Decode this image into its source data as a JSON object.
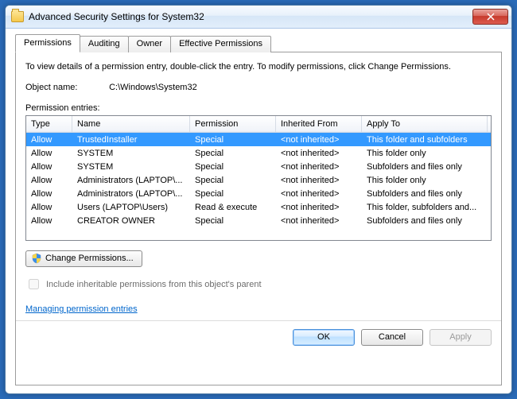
{
  "window": {
    "title": "Advanced Security Settings for System32"
  },
  "tabs": [
    {
      "label": "Permissions",
      "active": true
    },
    {
      "label": "Auditing",
      "active": false
    },
    {
      "label": "Owner",
      "active": false
    },
    {
      "label": "Effective Permissions",
      "active": false
    }
  ],
  "panel": {
    "intro": "To view details of a permission entry, double-click the entry. To modify permissions, click Change Permissions.",
    "object_label": "Object name:",
    "object_value": "C:\\Windows\\System32",
    "entries_label": "Permission entries:",
    "columns": {
      "type": "Type",
      "name": "Name",
      "permission": "Permission",
      "inherited": "Inherited From",
      "apply": "Apply To"
    },
    "rows": [
      {
        "type": "Allow",
        "name": "TrustedInstaller",
        "permission": "Special",
        "inherited": "<not inherited>",
        "apply": "This folder and subfolders",
        "selected": true
      },
      {
        "type": "Allow",
        "name": "SYSTEM",
        "permission": "Special",
        "inherited": "<not inherited>",
        "apply": "This folder only",
        "selected": false
      },
      {
        "type": "Allow",
        "name": "SYSTEM",
        "permission": "Special",
        "inherited": "<not inherited>",
        "apply": "Subfolders and files only",
        "selected": false
      },
      {
        "type": "Allow",
        "name": "Administrators (LAPTOP\\...",
        "permission": "Special",
        "inherited": "<not inherited>",
        "apply": "This folder only",
        "selected": false
      },
      {
        "type": "Allow",
        "name": "Administrators (LAPTOP\\...",
        "permission": "Special",
        "inherited": "<not inherited>",
        "apply": "Subfolders and files only",
        "selected": false
      },
      {
        "type": "Allow",
        "name": "Users (LAPTOP\\Users)",
        "permission": "Read & execute",
        "inherited": "<not inherited>",
        "apply": "This folder, subfolders and...",
        "selected": false
      },
      {
        "type": "Allow",
        "name": "CREATOR OWNER",
        "permission": "Special",
        "inherited": "<not inherited>",
        "apply": "Subfolders and files only",
        "selected": false
      }
    ],
    "change_button": "Change Permissions...",
    "include_checkbox": "Include inheritable permissions from this object's parent",
    "include_checked": false,
    "help_link": "Managing permission entries"
  },
  "buttons": {
    "ok": "OK",
    "cancel": "Cancel",
    "apply": "Apply"
  }
}
